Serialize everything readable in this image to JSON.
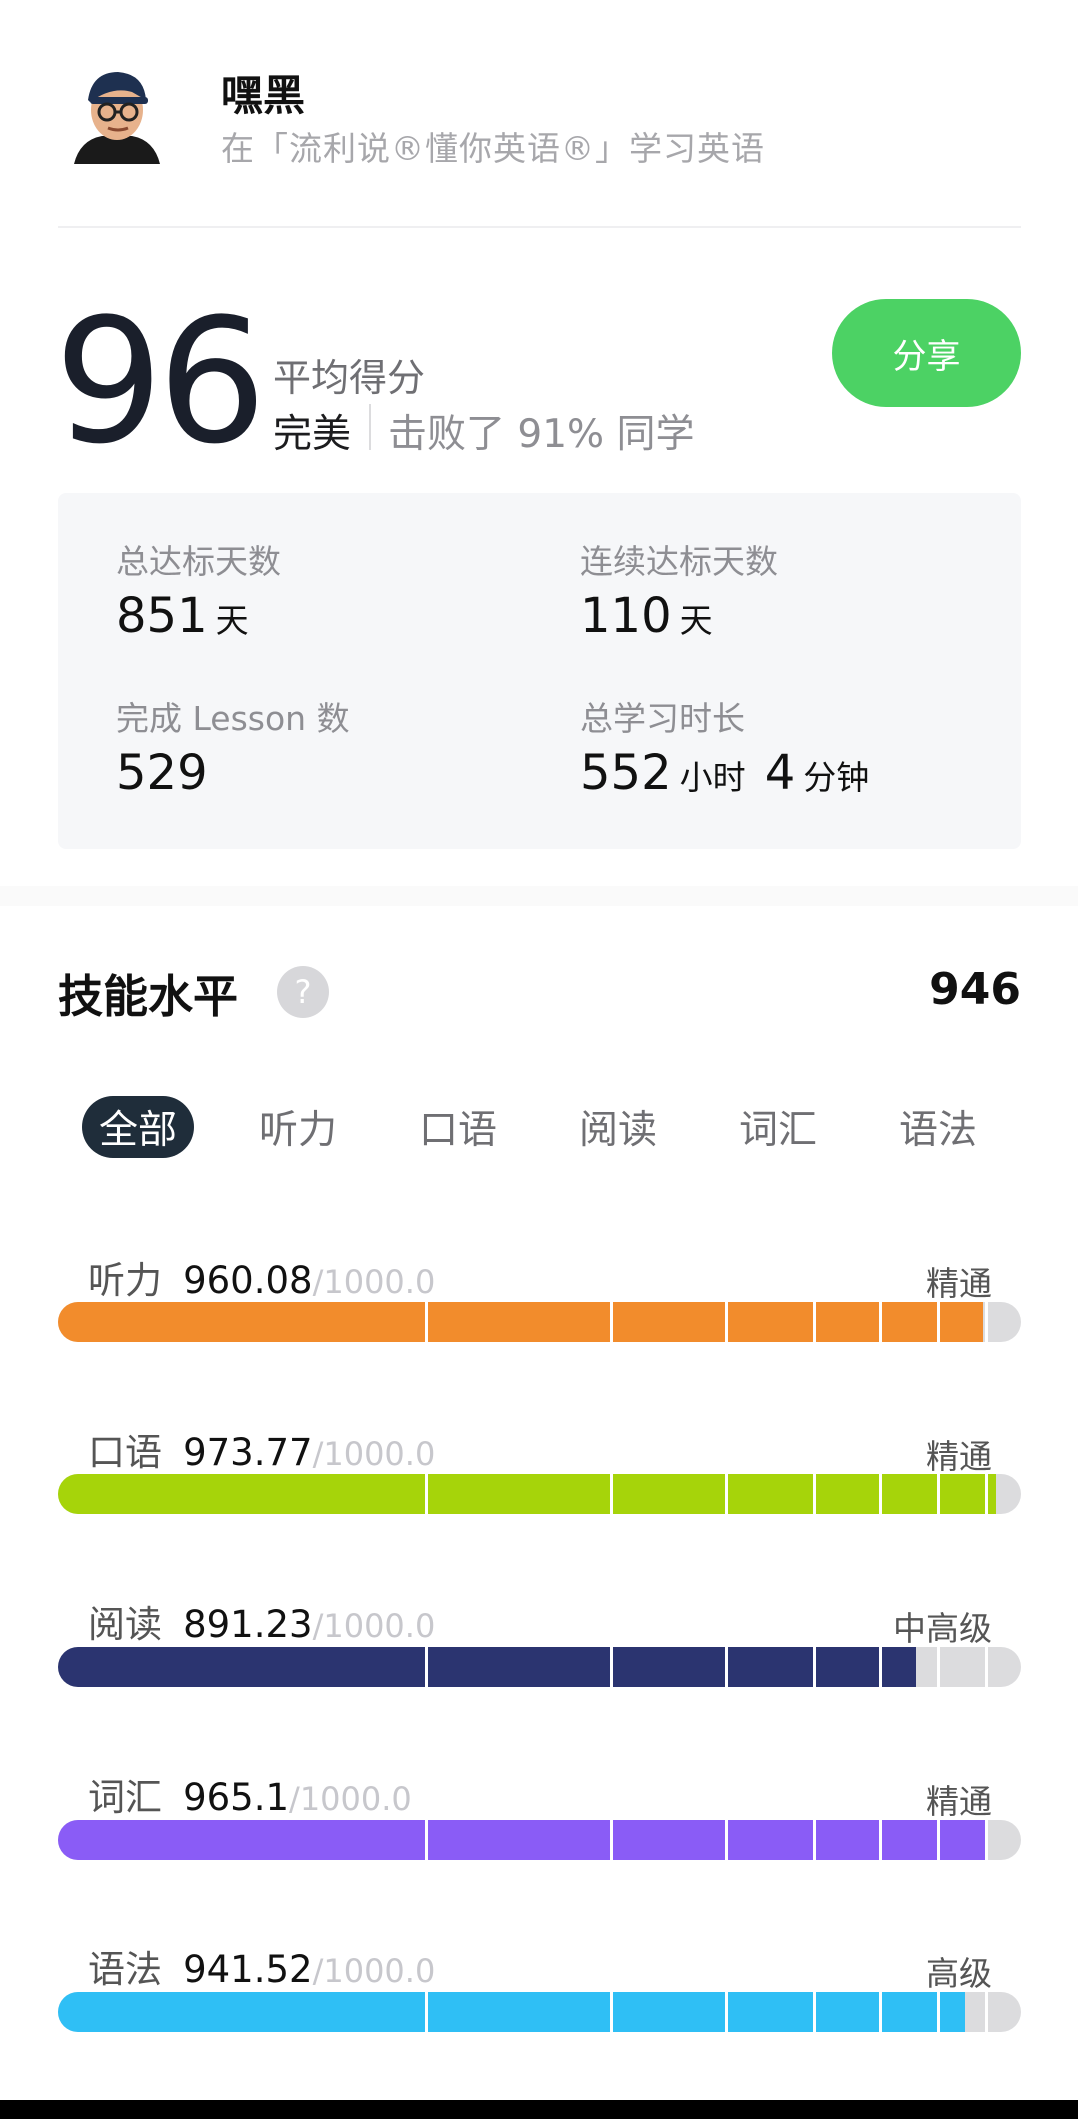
{
  "user": {
    "name": "嘿黑",
    "subtitle": "在「流利说®懂你英语®」学习英语"
  },
  "score": {
    "value": "96",
    "label": "平均得分",
    "rating": "完美",
    "rank_text": "击败了 91% 同学",
    "share_label": "分享",
    "share_color": "#4cd264"
  },
  "stats": {
    "total_days_label": "总达标天数",
    "total_days_value": "851",
    "total_days_unit": "天",
    "streak_label": "连续达标天数",
    "streak_value": "110",
    "streak_unit": "天",
    "lessons_label": "完成 Lesson 数",
    "lessons_value": "529",
    "study_time_label": "总学习时长",
    "study_hours": "552",
    "hours_unit": "小时",
    "study_minutes": "4",
    "minutes_unit": "分钟"
  },
  "skills_section": {
    "title": "技能水平",
    "help_icon": "?",
    "total": "946"
  },
  "tabs": [
    {
      "label": "全部"
    },
    {
      "label": "听力"
    },
    {
      "label": "口语"
    },
    {
      "label": "阅读"
    },
    {
      "label": "词汇"
    },
    {
      "label": "语法"
    }
  ],
  "skills": [
    {
      "name": "听力",
      "score": "960.08",
      "max": "/1000.0",
      "level": "精通",
      "color": "#f28c2c",
      "progress": 0.9601
    },
    {
      "name": "口语",
      "score": "973.77",
      "max": "/1000.0",
      "level": "精通",
      "color": "#a6d40a",
      "progress": 0.9738
    },
    {
      "name": "阅读",
      "score": "891.23",
      "max": "/1000.0",
      "level": "中高级",
      "color": "#2b3470",
      "progress": 0.8912
    },
    {
      "name": "词汇",
      "score": "965.1",
      "max": "/1000.0",
      "level": "精通",
      "color": "#8a5cf6",
      "progress": 0.9651
    },
    {
      "name": "语法",
      "score": "941.52",
      "max": "/1000.0",
      "level": "高级",
      "color": "#2fbff5",
      "progress": 0.9415
    }
  ]
}
